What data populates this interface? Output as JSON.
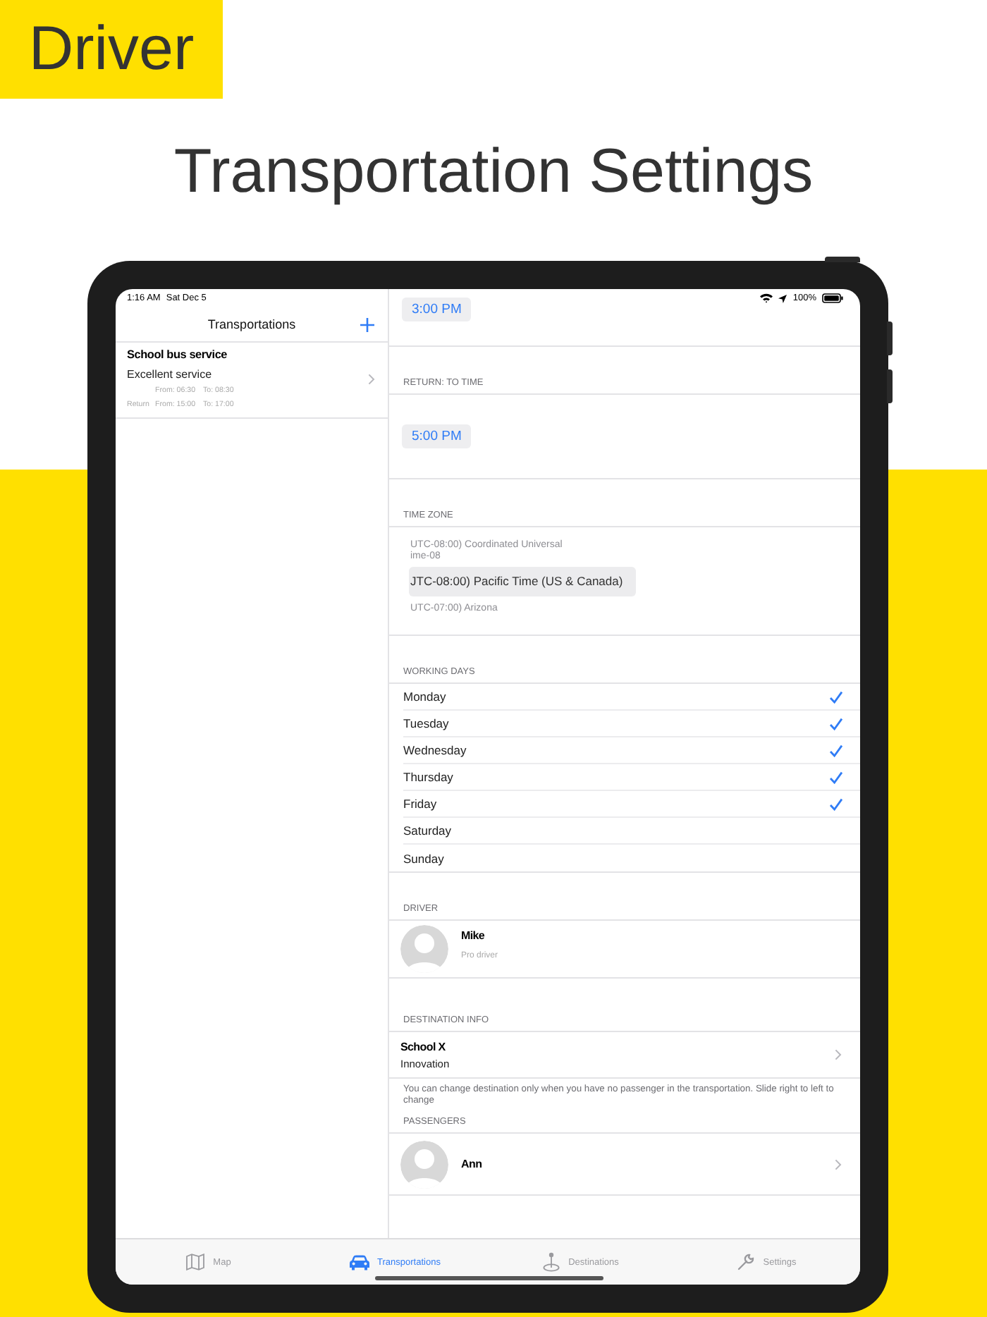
{
  "banner": {
    "label": "Driver"
  },
  "headline": "Transportation Settings",
  "status_bar": {
    "time": "1:16 AM",
    "date": "Sat Dec 5",
    "battery": "100%"
  },
  "sidebar": {
    "title": "Transportations",
    "items": [
      {
        "title": "School bus service",
        "subtitle": "Excellent service",
        "times": [
          {
            "from": "From: 06:30",
            "to": "To: 08:30"
          },
          {
            "label": "Return",
            "from": "From: 15:00",
            "to": "To: 17:00"
          }
        ]
      }
    ]
  },
  "start_time": {
    "value": "3:00 PM"
  },
  "return_time": {
    "header": "RETURN: TO TIME",
    "value": "5:00 PM"
  },
  "time_zone": {
    "header": "TIME ZONE",
    "options": [
      {
        "lines": [
          "UTC-08:00) Coordinated Universal",
          "ime-08"
        ],
        "selected": false
      },
      {
        "lines": [
          "JTC-08:00) Pacific Time (US & Canada)"
        ],
        "selected": true
      },
      {
        "lines": [
          "UTC-07:00) Arizona"
        ],
        "selected": false
      }
    ]
  },
  "working_days": {
    "header": "WORKING DAYS",
    "days": [
      {
        "name": "Monday",
        "checked": true
      },
      {
        "name": "Tuesday",
        "checked": true
      },
      {
        "name": "Wednesday",
        "checked": true
      },
      {
        "name": "Thursday",
        "checked": true
      },
      {
        "name": "Friday",
        "checked": true
      },
      {
        "name": "Saturday",
        "checked": false
      },
      {
        "name": "Sunday",
        "checked": false
      }
    ]
  },
  "driver": {
    "header": "DRIVER",
    "name": "Mike",
    "role": "Pro driver"
  },
  "destination": {
    "header": "DESTINATION INFO",
    "name": "School X",
    "subtitle": "Innovation",
    "note": "You can change destination only when you have no passenger in the transportation. Slide right to left to change"
  },
  "passengers": {
    "header": "PASSENGERS",
    "items": [
      {
        "name": "Ann"
      }
    ]
  },
  "tab_bar": [
    {
      "label": "Map",
      "kind": "map",
      "selected": false
    },
    {
      "label": "Transportations",
      "kind": "car",
      "selected": true
    },
    {
      "label": "Destinations",
      "kind": "pin",
      "selected": false
    },
    {
      "label": "Settings",
      "kind": "wrench",
      "selected": false
    }
  ]
}
